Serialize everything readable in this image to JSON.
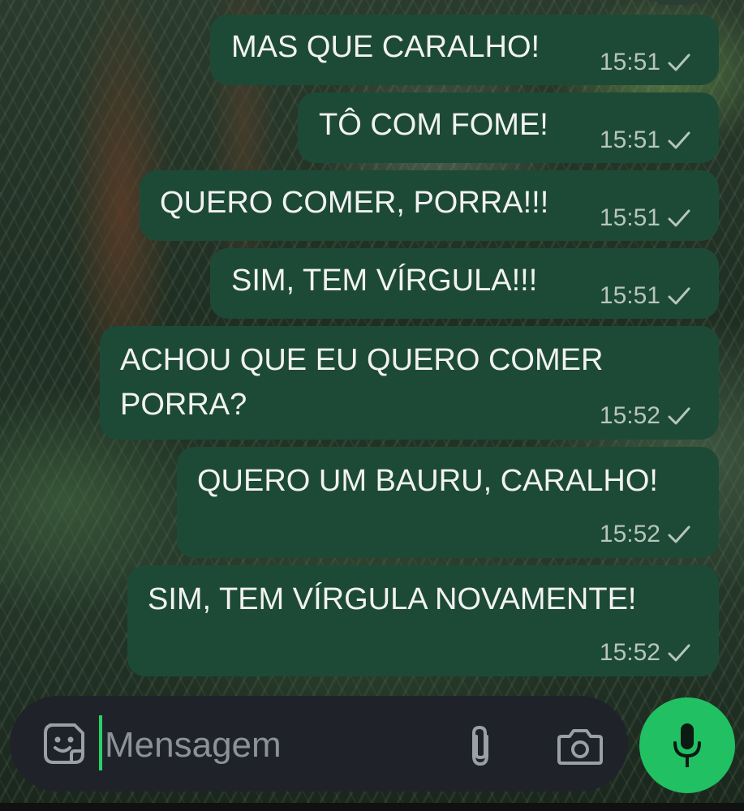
{
  "messages": [
    {
      "text": "MAS QUE CARALHO!",
      "time": "15:51",
      "status": "sent"
    },
    {
      "text": "TÔ COM FOME!",
      "time": "15:51",
      "status": "sent"
    },
    {
      "text": "QUERO COMER, PORRA!!!",
      "time": "15:51",
      "status": "sent"
    },
    {
      "text": "SIM, TEM VÍRGULA!!!",
      "time": "15:51",
      "status": "sent"
    },
    {
      "line1": "ACHOU QUE EU QUERO COMER",
      "line2": "PORRA?",
      "time": "15:52",
      "status": "sent"
    },
    {
      "text": "QUERO UM BAURU, CARALHO!",
      "time": "15:52",
      "status": "sent"
    },
    {
      "text": "SIM, TEM VÍRGULA NOVAMENTE!",
      "time": "15:52",
      "status": "sent"
    }
  ],
  "composer": {
    "placeholder": "Mensagem"
  },
  "icons": {
    "sticker": "sticker-icon",
    "attach": "paperclip-icon",
    "camera": "camera-icon",
    "mic": "mic-icon",
    "check": "single-check-icon"
  },
  "colors": {
    "bubble": "#1d4a36",
    "accent": "#21c063",
    "input_bar": "#1f2329",
    "placeholder_text": "#8b9298",
    "meta_text": "#b7c5bd"
  }
}
